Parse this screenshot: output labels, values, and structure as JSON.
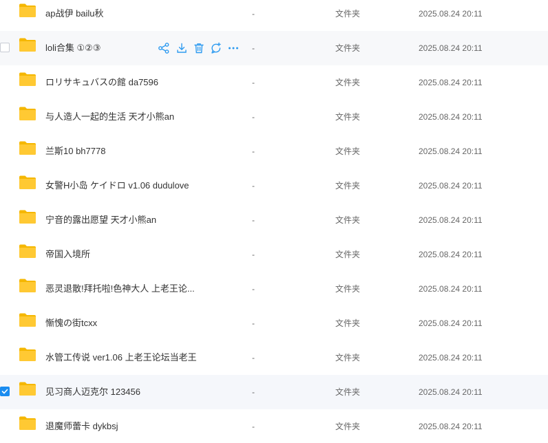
{
  "files": [
    {
      "name": "ap战伊 bailu秋",
      "size": "-",
      "type": "文件夹",
      "modified": "2025.08.24 20:11"
    },
    {
      "name": "loli合集 ①②③",
      "size": "-",
      "type": "文件夹",
      "modified": "2025.08.24 20:11"
    },
    {
      "name": "ロリサキュバスの館 da7596",
      "size": "-",
      "type": "文件夹",
      "modified": "2025.08.24 20:11"
    },
    {
      "name": "与人造人一起的生活 天才小熊an",
      "size": "-",
      "type": "文件夹",
      "modified": "2025.08.24 20:11"
    },
    {
      "name": "兰斯10 bh7778",
      "size": "-",
      "type": "文件夹",
      "modified": "2025.08.24 20:11"
    },
    {
      "name": "女警H小岛 ケイドロ v1.06 dudulove",
      "size": "-",
      "type": "文件夹",
      "modified": "2025.08.24 20:11"
    },
    {
      "name": "宁音的露出愿望 天才小熊an",
      "size": "-",
      "type": "文件夹",
      "modified": "2025.08.24 20:11"
    },
    {
      "name": "帝国入境所",
      "size": "-",
      "type": "文件夹",
      "modified": "2025.08.24 20:11"
    },
    {
      "name": "恶灵退散!拜托啦!色神大人 上老王论...",
      "size": "-",
      "type": "文件夹",
      "modified": "2025.08.24 20:11"
    },
    {
      "name": "慚愧の街tcxx",
      "size": "-",
      "type": "文件夹",
      "modified": "2025.08.24 20:11"
    },
    {
      "name": "水管工传说 ver1.06 上老王论坛当老王",
      "size": "-",
      "type": "文件夹",
      "modified": "2025.08.24 20:11"
    },
    {
      "name": "见习商人迈克尔 123456",
      "size": "-",
      "type": "文件夹",
      "modified": "2025.08.24 20:11"
    },
    {
      "name": "退魔师蕾卡 dykbsj",
      "size": "-",
      "type": "文件夹",
      "modified": "2025.08.24 20:11"
    }
  ],
  "hovered_row": 1,
  "selected_row": 11,
  "row_actions": [
    "share-icon",
    "download-icon",
    "delete-icon",
    "comment-icon",
    "more-icon"
  ],
  "colors": {
    "folder": "#FFC933",
    "folder_back": "#F5B700",
    "accent": "#1A8CF0",
    "action_icon": "#2C9AF0"
  }
}
